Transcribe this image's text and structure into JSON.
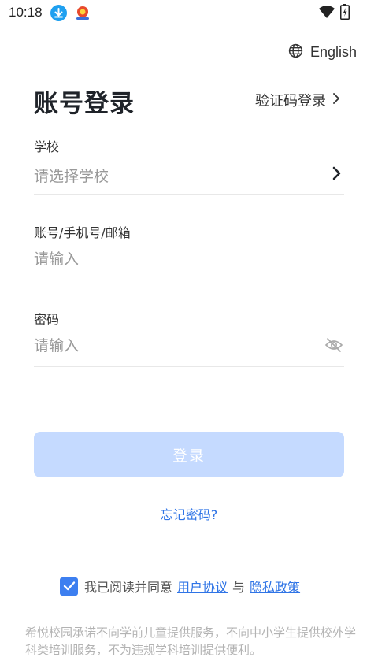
{
  "status_bar": {
    "time": "10:18",
    "icons": [
      "download-icon",
      "app-notification-icon",
      "wifi-icon",
      "battery-icon"
    ]
  },
  "language": {
    "label": "English",
    "icon": "globe-icon"
  },
  "login": {
    "title": "账号登录",
    "switch_label": "验证码登录",
    "school": {
      "label": "学校",
      "placeholder": "请选择学校"
    },
    "account": {
      "label": "账号/手机号/邮箱",
      "placeholder": "请输入"
    },
    "password": {
      "label": "密码",
      "placeholder": "请输入"
    },
    "submit_label": "登录",
    "forgot_label": "忘记密码?"
  },
  "agreement": {
    "checked": true,
    "prefix": "我已阅读并同意",
    "user_agreement": "用户协议",
    "conjunction": "与",
    "privacy_policy": "隐私政策"
  },
  "disclaimer": "希悦校园承诺不向学前儿童提供服务，不向中小学生提供校外学科类培训服务，不为违规学科培训提供便利。",
  "colors": {
    "accent": "#2f74e6",
    "button_disabled": "#c5daff",
    "checkbox": "#3d7ff0",
    "placeholder": "#999999"
  }
}
